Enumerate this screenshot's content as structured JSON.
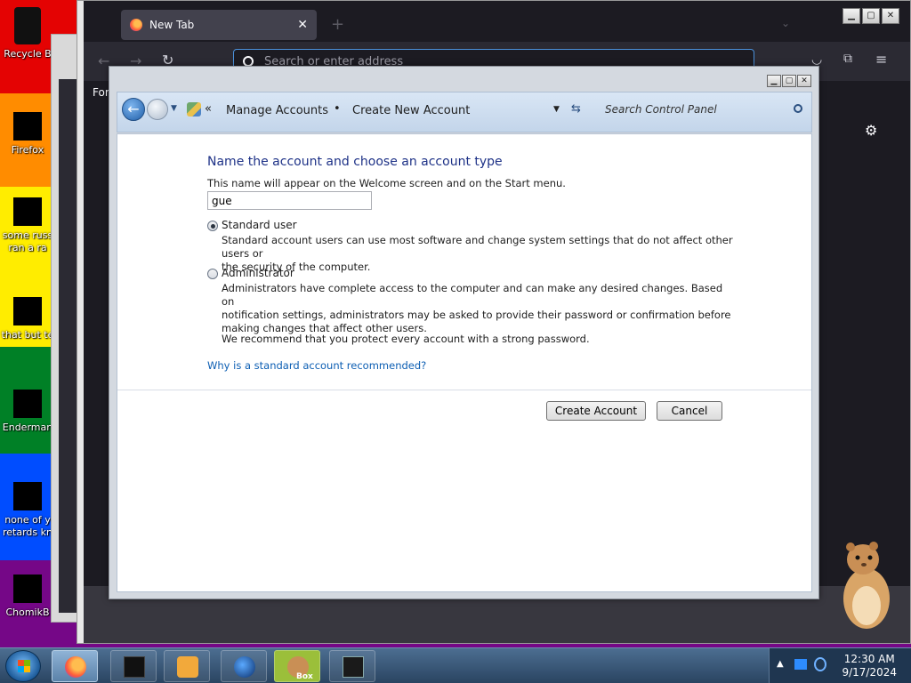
{
  "desktop": {
    "icons": [
      {
        "label": "Recycle B"
      },
      {
        "label": "Firefox"
      },
      {
        "label": "some russ",
        "label2": "ran a ra"
      },
      {
        "label": "that but te"
      },
      {
        "label": "Enderman"
      },
      {
        "label": "none of y",
        "label2": "retards kn"
      },
      {
        "label": "ChomikB"
      }
    ]
  },
  "browser": {
    "tab_title": "New Tab",
    "address_placeholder": "Search or enter address",
    "sidebar_text": "For",
    "sidebar_text_back": "F"
  },
  "control_panel": {
    "breadcrumb": [
      "Manage Accounts",
      "Create New Account"
    ],
    "search_placeholder": "Search Control Panel",
    "heading": "Name the account and choose an account type",
    "subtext": "This name will appear on the Welcome screen and on the Start menu.",
    "name_value": "gue",
    "options": [
      {
        "label": "Standard user",
        "selected": true,
        "desc_lines": [
          "Standard account users can use most software and change system settings that do not affect other users or",
          "the security of the computer."
        ]
      },
      {
        "label": "Administrator",
        "selected": false,
        "desc_lines": [
          "Administrators have complete access to the computer and can make any desired changes. Based on",
          "notification settings, administrators may be asked to provide their password or confirmation before",
          "making changes that affect other users."
        ]
      }
    ],
    "recommendation": "We recommend that you protect every account with a strong password.",
    "why_link": "Why is a standard account recommended?",
    "create_button": "Create Account",
    "cancel_button": "Cancel"
  },
  "taskbar": {
    "time": "12:30 AM",
    "date": "9/17/2024",
    "box_label": "Box"
  }
}
